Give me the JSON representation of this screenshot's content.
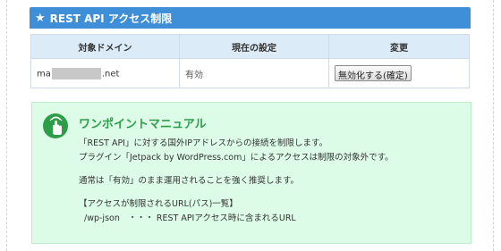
{
  "section": {
    "title": "REST API アクセス制限",
    "icon": "star-icon"
  },
  "table": {
    "headers": [
      "対象ドメイン",
      "現在の設定",
      "変更"
    ],
    "rows": [
      {
        "domain_prefix": "ma",
        "domain_suffix": ".net",
        "status": "有効",
        "action_label": "無効化する(確定)"
      }
    ]
  },
  "tip": {
    "icon": "tap-hand-icon",
    "title": "ワンポイントマニュアル",
    "lines": [
      "「REST API」に対する国外IPアドレスからの接続を制限します。",
      "プラグイン「Jetpack by WordPress.com」によるアクセスは制限の対象外です。",
      "通常は「有効」のまま運用されることを強く推奨します。",
      "【アクセスが制限されるURL(パス)一覧】",
      "/wp-json　・・・ REST APIアクセス時に含まれるURL"
    ]
  },
  "colors": {
    "header_bg": "#3f8ed8",
    "table_header_bg": "#dcebf8",
    "tip_bg": "#ddfce7",
    "tip_accent": "#2e9d48"
  }
}
